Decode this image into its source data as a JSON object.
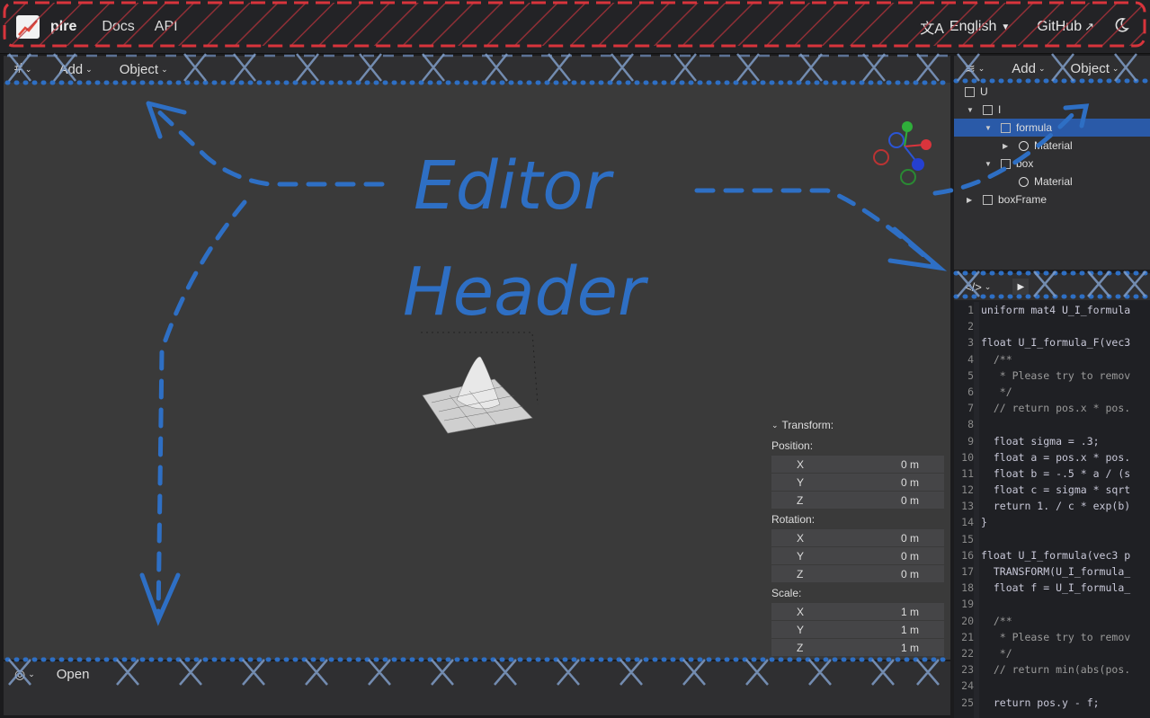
{
  "topbar": {
    "brand": "plre",
    "nav": [
      "Docs",
      "API"
    ],
    "language": "English",
    "github": "GitHub"
  },
  "viewport": {
    "add_label": "Add",
    "object_label": "Object",
    "grid_icon": "grid-icon"
  },
  "outliner": {
    "add_label": "Add",
    "object_label": "Object",
    "tree": [
      {
        "label": "U",
        "depth": 0,
        "icon": "scene-icon"
      },
      {
        "label": "I",
        "depth": 0,
        "icon": "object-icon",
        "expanded": true
      },
      {
        "label": "formula",
        "depth": 1,
        "icon": "object-icon",
        "expanded": true,
        "selected": true
      },
      {
        "label": "Material",
        "depth": 2,
        "icon": "material-icon"
      },
      {
        "label": "box",
        "depth": 1,
        "icon": "object-icon",
        "expanded": true
      },
      {
        "label": "Material",
        "depth": 2,
        "icon": "material-icon"
      },
      {
        "label": "boxFrame",
        "depth": 0,
        "icon": "object-icon"
      }
    ]
  },
  "transform": {
    "title": "Transform:",
    "position_label": "Position:",
    "rotation_label": "Rotation:",
    "scale_label": "Scale:",
    "position": [
      {
        "axis": "X",
        "value": "0 m"
      },
      {
        "axis": "Y",
        "value": "0 m"
      },
      {
        "axis": "Z",
        "value": "0 m"
      }
    ],
    "rotation": [
      {
        "axis": "X",
        "value": "0 m"
      },
      {
        "axis": "Y",
        "value": "0 m"
      },
      {
        "axis": "Z",
        "value": "0 m"
      }
    ],
    "scale": [
      {
        "axis": "X",
        "value": "1 m"
      },
      {
        "axis": "Y",
        "value": "1 m"
      },
      {
        "axis": "Z",
        "value": "1 m"
      }
    ]
  },
  "bottom": {
    "open_label": "Open"
  },
  "code": {
    "lines": [
      "uniform mat4 U_I_formula",
      "",
      "float U_I_formula_F(vec3",
      "  /**",
      "   * Please try to remov",
      "   */",
      "  // return pos.x * pos.",
      "",
      "  float sigma = .3;",
      "  float a = pos.x * pos.",
      "  float b = -.5 * a / (s",
      "  float c = sigma * sqrt",
      "  return 1. / c * exp(b)",
      "}",
      "",
      "float U_I_formula(vec3 p",
      "  TRANSFORM(U_I_formula_",
      "  float f = U_I_formula_",
      "",
      "  /**",
      "   * Please try to remov",
      "   */",
      "  // return min(abs(pos.",
      "",
      "  return pos.y - f;"
    ]
  },
  "annotation": {
    "line1": "Editor",
    "line2": "Header"
  },
  "colors": {
    "accent": "#2a5aa8",
    "annotation_blue": "#2e6fc4",
    "annotation_red": "#d9343c"
  }
}
